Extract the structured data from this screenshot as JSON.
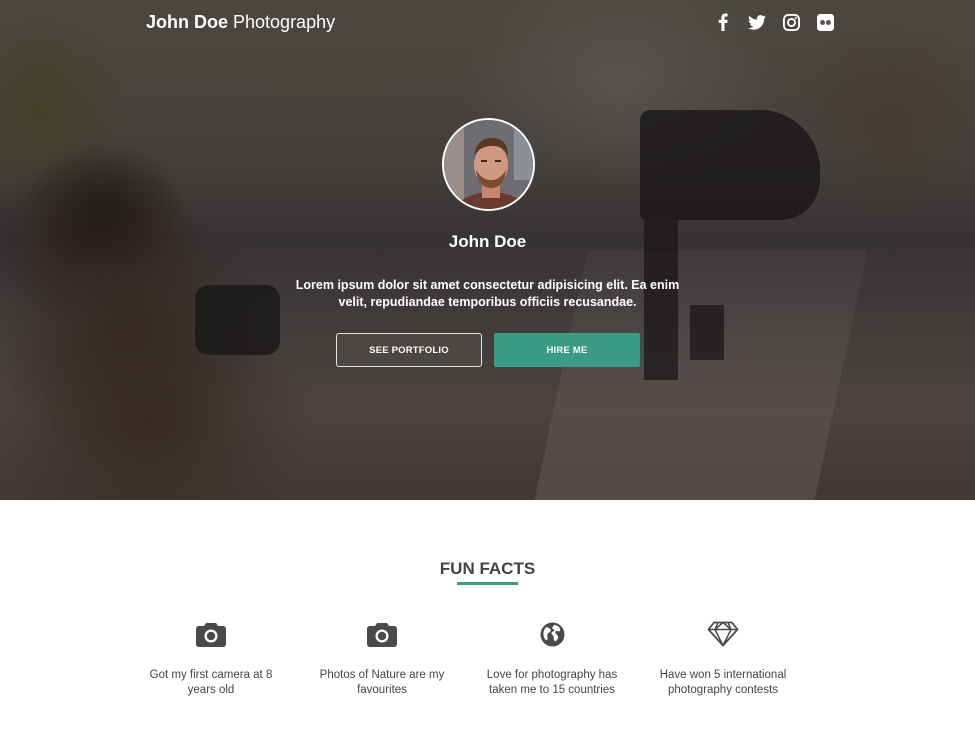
{
  "nav": {
    "brand_strong": "John Doe",
    "brand_rest": " Photography",
    "social_icons": [
      "facebook-icon",
      "twitter-icon",
      "instagram-icon",
      "flickr-icon"
    ]
  },
  "profile": {
    "name": "John Doe",
    "tagline": "Lorem ipsum dolor sit amet consectetur adipisicing elit. Ea enim velit, repudiandae temporibus officiis recusandae."
  },
  "buttons": {
    "portfolio": "SEE PORTFOLIO",
    "hire": "HIRE ME"
  },
  "facts": {
    "title": "FUN FACTS",
    "items": [
      {
        "icon": "camera-icon",
        "text": "Got my first camera at 8 years old"
      },
      {
        "icon": "camera-icon",
        "text": "Photos of Nature are my favourites"
      },
      {
        "icon": "globe-icon",
        "text": "Love for photography has taken me to 15 countries"
      },
      {
        "icon": "diamond-icon",
        "text": "Have won 5 international photography contests"
      }
    ]
  },
  "colors": {
    "accent": "#3a9c85",
    "heading_text": "#444444",
    "hero_text": "#ffffff"
  }
}
